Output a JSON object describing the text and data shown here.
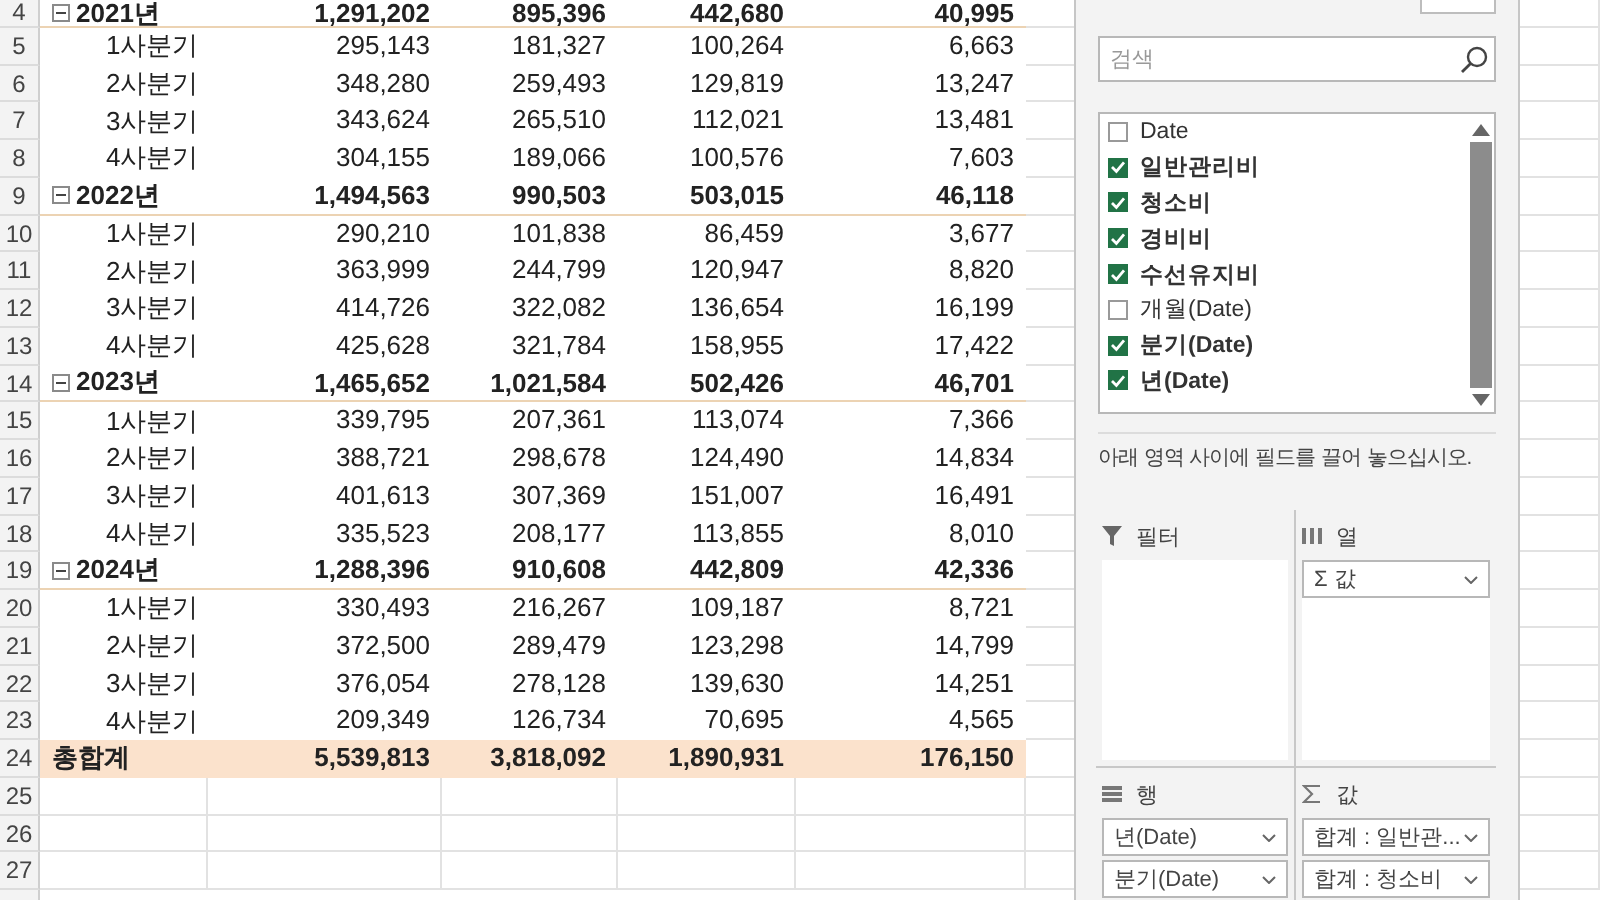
{
  "sheet": {
    "pivot_rows": [
      {
        "row_number": "4",
        "kind": "year",
        "expanded": true,
        "label": "2021년",
        "values": [
          "1,291,202",
          "895,396",
          "442,680",
          "40,995"
        ]
      },
      {
        "row_number": "5",
        "kind": "quarter",
        "label": "1사분기",
        "values": [
          "295,143",
          "181,327",
          "100,264",
          "6,663"
        ]
      },
      {
        "row_number": "6",
        "kind": "quarter",
        "label": "2사분기",
        "values": [
          "348,280",
          "259,493",
          "129,819",
          "13,247"
        ]
      },
      {
        "row_number": "7",
        "kind": "quarter",
        "label": "3사분기",
        "values": [
          "343,624",
          "265,510",
          "112,021",
          "13,481"
        ]
      },
      {
        "row_number": "8",
        "kind": "quarter",
        "label": "4사분기",
        "values": [
          "304,155",
          "189,066",
          "100,576",
          "7,603"
        ]
      },
      {
        "row_number": "9",
        "kind": "year",
        "expanded": true,
        "label": "2022년",
        "values": [
          "1,494,563",
          "990,503",
          "503,015",
          "46,118"
        ]
      },
      {
        "row_number": "10",
        "kind": "quarter",
        "label": "1사분기",
        "values": [
          "290,210",
          "101,838",
          "86,459",
          "3,677"
        ]
      },
      {
        "row_number": "11",
        "kind": "quarter",
        "label": "2사분기",
        "values": [
          "363,999",
          "244,799",
          "120,947",
          "8,820"
        ]
      },
      {
        "row_number": "12",
        "kind": "quarter",
        "label": "3사분기",
        "values": [
          "414,726",
          "322,082",
          "136,654",
          "16,199"
        ]
      },
      {
        "row_number": "13",
        "kind": "quarter",
        "label": "4사분기",
        "values": [
          "425,628",
          "321,784",
          "158,955",
          "17,422"
        ]
      },
      {
        "row_number": "14",
        "kind": "year",
        "expanded": true,
        "label": "2023년",
        "values": [
          "1,465,652",
          "1,021,584",
          "502,426",
          "46,701"
        ]
      },
      {
        "row_number": "15",
        "kind": "quarter",
        "label": "1사분기",
        "values": [
          "339,795",
          "207,361",
          "113,074",
          "7,366"
        ]
      },
      {
        "row_number": "16",
        "kind": "quarter",
        "label": "2사분기",
        "values": [
          "388,721",
          "298,678",
          "124,490",
          "14,834"
        ]
      },
      {
        "row_number": "17",
        "kind": "quarter",
        "label": "3사분기",
        "values": [
          "401,613",
          "307,369",
          "151,007",
          "16,491"
        ]
      },
      {
        "row_number": "18",
        "kind": "quarter",
        "label": "4사분기",
        "values": [
          "335,523",
          "208,177",
          "113,855",
          "8,010"
        ]
      },
      {
        "row_number": "19",
        "kind": "year",
        "expanded": true,
        "label": "2024년",
        "values": [
          "1,288,396",
          "910,608",
          "442,809",
          "42,336"
        ]
      },
      {
        "row_number": "20",
        "kind": "quarter",
        "label": "1사분기",
        "values": [
          "330,493",
          "216,267",
          "109,187",
          "8,721"
        ]
      },
      {
        "row_number": "21",
        "kind": "quarter",
        "label": "2사분기",
        "values": [
          "372,500",
          "289,479",
          "123,298",
          "14,799"
        ]
      },
      {
        "row_number": "22",
        "kind": "quarter",
        "label": "3사분기",
        "values": [
          "376,054",
          "278,128",
          "139,630",
          "14,251"
        ]
      },
      {
        "row_number": "23",
        "kind": "quarter",
        "label": "4사분기",
        "values": [
          "209,349",
          "126,734",
          "70,695",
          "4,565"
        ]
      },
      {
        "row_number": "24",
        "kind": "total",
        "label": "총합계",
        "values": [
          "5,539,813",
          "3,818,092",
          "1,890,931",
          "176,150"
        ]
      }
    ],
    "empty_rows": [
      "25",
      "26",
      "27"
    ]
  },
  "field_pane": {
    "search": {
      "placeholder": "검색"
    },
    "fields": [
      {
        "label": "Date",
        "checked": false
      },
      {
        "label": "일반관리비",
        "checked": true
      },
      {
        "label": "청소비",
        "checked": true
      },
      {
        "label": "경비비",
        "checked": true
      },
      {
        "label": "수선유지비",
        "checked": true
      },
      {
        "label": "개월(Date)",
        "checked": false
      },
      {
        "label": "분기(Date)",
        "checked": true
      },
      {
        "label": "년(Date)",
        "checked": true
      }
    ],
    "instruction": "아래 영역 사이에 필드를 끌어 놓으십시오.",
    "areas": [
      {
        "kind": "filter",
        "title": "필터"
      },
      {
        "kind": "columns",
        "title": "열",
        "items": [
          "Σ 값"
        ]
      },
      {
        "kind": "rows",
        "title": "행",
        "items": [
          "년(Date)",
          "분기(Date)"
        ]
      },
      {
        "kind": "values",
        "title": "값",
        "items": [
          "합계 : 일반관...",
          "합계 : 청소비"
        ]
      }
    ]
  }
}
